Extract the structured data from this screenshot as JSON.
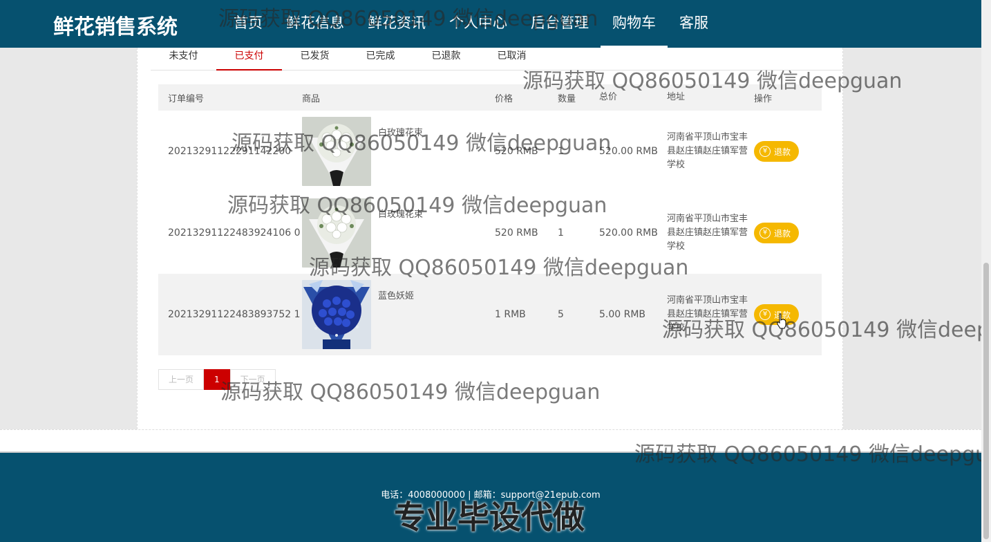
{
  "header": {
    "brand": "鲜花销售系统",
    "nav": [
      "首页",
      "鲜花信息",
      "鲜花资讯",
      "个人中心",
      "后台管理",
      "购物车",
      "客服"
    ],
    "active_nav": "购物车"
  },
  "tabs": [
    "未支付",
    "已支付",
    "已发货",
    "已完成",
    "已退款",
    "已取消"
  ],
  "active_tab": "已支付",
  "table": {
    "headers": [
      "订单编号",
      "商品",
      "价格",
      "数量",
      "总价",
      "地址",
      "操作"
    ],
    "rows": [
      {
        "order_no": "20213291122291142200",
        "product": "白玫瑰花束",
        "price": "520 RMB",
        "qty": "1",
        "total": "520.00 RMB",
        "address": "河南省平顶山市宝丰县赵庄镇赵庄镇军营学校",
        "action": "退款"
      },
      {
        "order_no": "20213291122483924106 0",
        "product": "白玫瑰花束",
        "price": "520 RMB",
        "qty": "1",
        "total": "520.00 RMB",
        "address": "河南省平顶山市宝丰县赵庄镇赵庄镇军营学校",
        "action": "退款"
      },
      {
        "order_no": "20213291122483893752 1",
        "product": "蓝色妖姬",
        "price": "1 RMB",
        "qty": "5",
        "total": "5.00 RMB",
        "address": "河南省平顶山市宝丰县赵庄镇赵庄镇军营学校",
        "action": "退款"
      }
    ]
  },
  "pager": {
    "prev": "上一页",
    "current": "1",
    "next": "下一页"
  },
  "footer": {
    "info": "电话：4008000000 | 邮箱：support@21epub.com"
  },
  "watermark": {
    "text": "源码获取 QQ86050149 微信deepguan",
    "big": "专业毕设代做"
  },
  "colors": {
    "header_bg": "#06516f",
    "accent_red": "#cc0000",
    "refund_btn": "#f5b800"
  }
}
